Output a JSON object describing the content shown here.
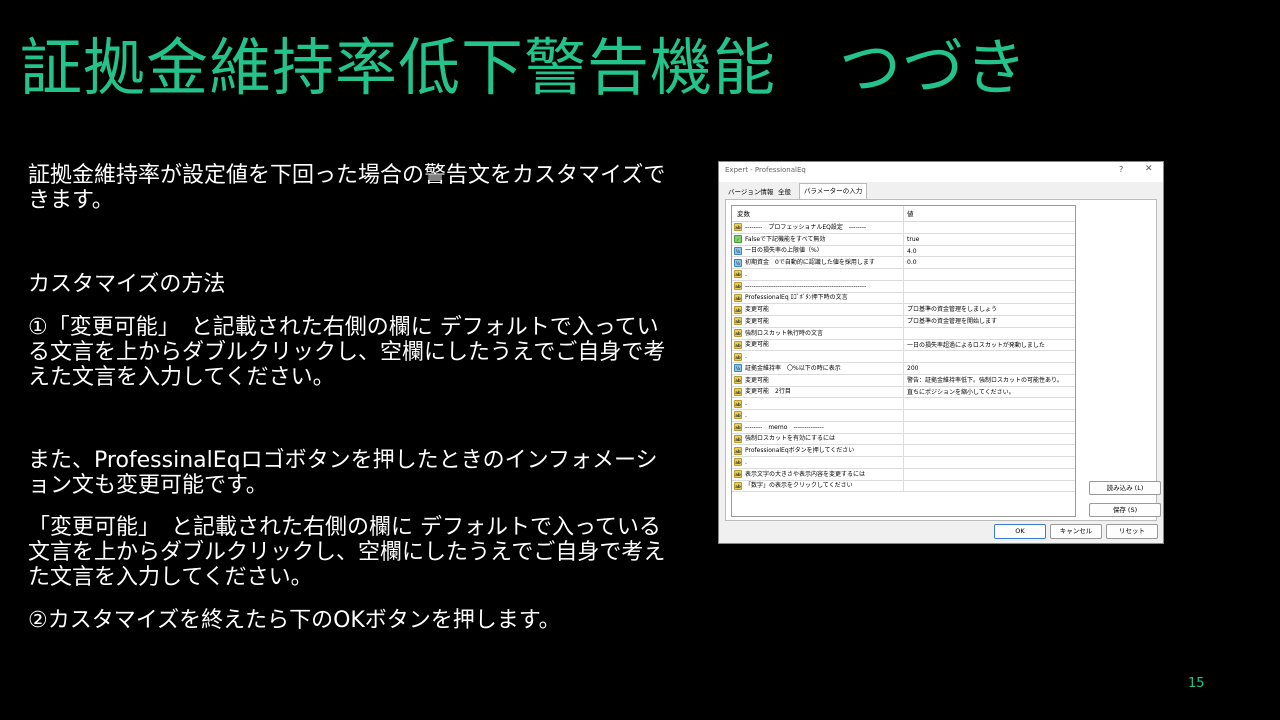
{
  "slide": {
    "title": "証拠金維持率低下警告機能　つづき",
    "paragraph1": "証拠金維持率が設定値を下回った場合の警告文をカスタマイズできます。",
    "paragraph2": "カスタマイズの方法",
    "paragraph3": "①「変更可能」　と記載された右側の欄に デフォルトで入っている文言を上からダブルクリックし、空欄にしたうえでご自身で考えた文言を入力してください。",
    "paragraph4": "また、ProfessinalEqロゴボタンを押したときのインフォメーション文も変更可能です。",
    "paragraph5": "「変更可能」　と記載された右側の欄に デフォルトで入っている文言を上からダブルクリックし、空欄にしたうえでご自身で考えた文言を入力してください。",
    "paragraph6": "②カスタマイズを終えたら下のOKボタンを押します。",
    "page_number": "15"
  },
  "dialog": {
    "title": "Expert - ProfessionalEq",
    "help_glyph": "?",
    "close_glyph": "✕",
    "tabs": [
      "バージョン情報",
      "全般",
      "パラメーターの入力"
    ],
    "grid": {
      "column_variable": "変数",
      "column_value": "値",
      "rows": [
        {
          "icon": "ab",
          "variable": "--------　プロフェッショナルEQ設定　--------",
          "value": ""
        },
        {
          "icon": "bool",
          "variable": "Falseで下記機能をすべて無効",
          "value": "true"
        },
        {
          "icon": "num",
          "variable": "一日の損失率の上限値（%）",
          "value": "4.0"
        },
        {
          "icon": "num",
          "variable": "初期資金　0で自動的に認識した値を採用します",
          "value": "0.0"
        },
        {
          "icon": "ab",
          "variable": ".",
          "value": ""
        },
        {
          "icon": "ab",
          "variable": "--------------------------------------------------------",
          "value": ""
        },
        {
          "icon": "ab",
          "variable": "ProfessionalEq ﾛｺﾞﾎﾞﾀﾝ押下時の文言",
          "value": ""
        },
        {
          "icon": "ab",
          "variable": "変更可能",
          "value": "プロ基準の資金管理をしましょう"
        },
        {
          "icon": "ab",
          "variable": "変更可能",
          "value": "プロ基準の資金管理を開始します"
        },
        {
          "icon": "ab",
          "variable": "強制ロスカット執行時の文言",
          "value": ""
        },
        {
          "icon": "ab",
          "variable": "変更可能",
          "value": "一日の損失率超過によるロスカットが発動しました"
        },
        {
          "icon": "ab",
          "variable": ".",
          "value": ""
        },
        {
          "icon": "num",
          "variable": "証拠金維持率　〇%以下の時に表示",
          "value": "200"
        },
        {
          "icon": "ab",
          "variable": "変更可能",
          "value": "警告：証拠金維持率低下。強制ロスカットの可能性あり。"
        },
        {
          "icon": "ab",
          "variable": "変更可能　2行目",
          "value": "直ちにポジションを縮小してください。"
        },
        {
          "icon": "ab",
          "variable": ".",
          "value": ""
        },
        {
          "icon": "ab",
          "variable": ".",
          "value": ""
        },
        {
          "icon": "ab",
          "variable": "--------　memo　--------------",
          "value": ""
        },
        {
          "icon": "ab",
          "variable": "強制ロスカットを有効にするには",
          "value": ""
        },
        {
          "icon": "ab",
          "variable": "ProfessionalEqボタンを押してください",
          "value": ""
        },
        {
          "icon": "ab",
          "variable": ".",
          "value": ""
        },
        {
          "icon": "ab",
          "variable": "表示文字の大きさや表示内容を変更するには",
          "value": ""
        },
        {
          "icon": "ab",
          "variable": "「数字」の表示をクリックしてください",
          "value": ""
        }
      ]
    },
    "buttons": {
      "load": "読み込み (L)",
      "save": "保存 (S)",
      "ok": "OK",
      "cancel": "キャンセル",
      "reset": "リセット"
    }
  },
  "colors": {
    "accent": "#22c48c",
    "background": "#000000",
    "text": "#ffffff"
  }
}
